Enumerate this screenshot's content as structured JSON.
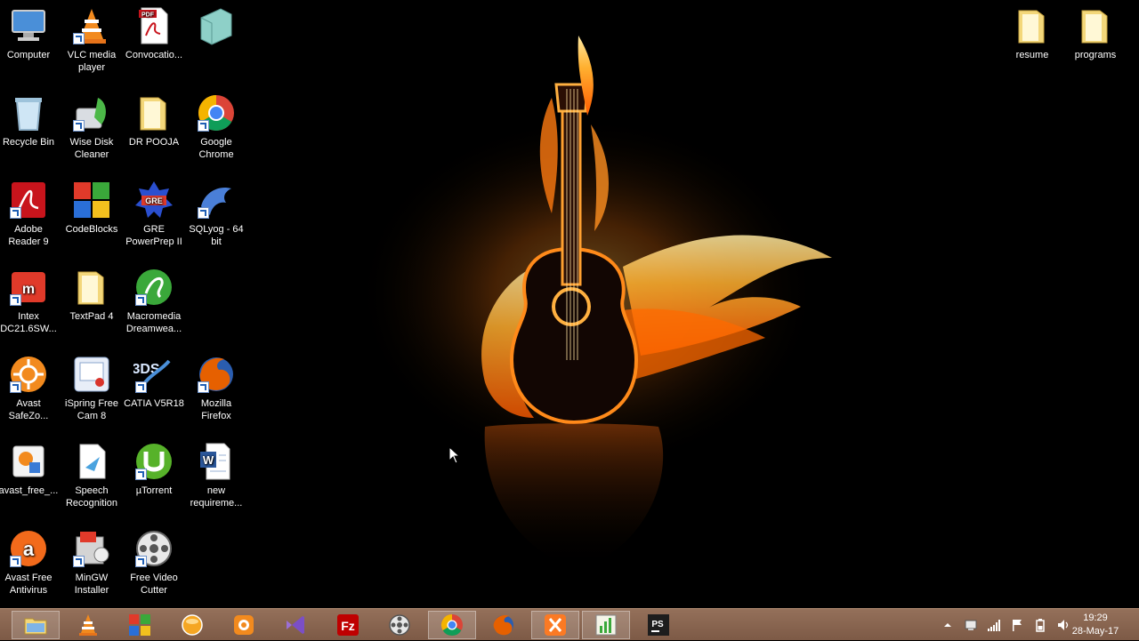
{
  "desktop": {
    "icons": [
      {
        "label": "Computer",
        "icon": "computer-icon"
      },
      {
        "label": "VLC media player",
        "icon": "vlc-icon"
      },
      {
        "label": "Convocatio...",
        "icon": "pdf-file-icon"
      },
      {
        "label": "",
        "icon": "generic-app-icon"
      },
      {
        "label": "Recycle Bin",
        "icon": "recycle-bin-icon"
      },
      {
        "label": "Wise Disk Cleaner",
        "icon": "wise-disk-cleaner-icon"
      },
      {
        "label": "DR POOJA",
        "icon": "folder-icon"
      },
      {
        "label": "Google Chrome",
        "icon": "chrome-icon"
      },
      {
        "label": "Adobe Reader 9",
        "icon": "adobe-reader-icon"
      },
      {
        "label": "CodeBlocks",
        "icon": "codeblocks-icon"
      },
      {
        "label": "GRE PowerPrep II",
        "icon": "gre-icon"
      },
      {
        "label": "SQLyog - 64 bit",
        "icon": "sqlyog-icon"
      },
      {
        "label": "Intex DC21.6SW...",
        "icon": "intex-icon"
      },
      {
        "label": "TextPad 4",
        "icon": "folder-icon"
      },
      {
        "label": "Macromedia Dreamwea...",
        "icon": "dreamweaver-icon"
      },
      {
        "label": "Avast SafeZo...",
        "icon": "avast-safezone-icon"
      },
      {
        "label": "iSpring Free Cam 8",
        "icon": "ispring-icon"
      },
      {
        "label": "CATIA V5R18",
        "icon": "catia-icon"
      },
      {
        "label": "Mozilla Firefox",
        "icon": "firefox-icon"
      },
      {
        "label": "avast_free_...",
        "icon": "installer-icon"
      },
      {
        "label": "Speech Recognition",
        "icon": "speech-recognition-icon"
      },
      {
        "label": "µTorrent",
        "icon": "utorrent-icon"
      },
      {
        "label": "new requireme...",
        "icon": "word-doc-icon"
      },
      {
        "label": "Avast Free Antivirus",
        "icon": "avast-icon"
      },
      {
        "label": "MinGW Installer",
        "icon": "mingw-icon"
      },
      {
        "label": "Free Video Cutter",
        "icon": "video-cutter-icon"
      },
      {
        "label": "resume",
        "icon": "folder-icon"
      },
      {
        "label": "programs",
        "icon": "folder-icon"
      }
    ]
  },
  "taskbar": {
    "pinned": [
      {
        "name": "file-explorer",
        "icon": "folder-icon",
        "active": true
      },
      {
        "name": "vlc",
        "icon": "vlc-icon",
        "active": false
      },
      {
        "name": "codeblocks",
        "icon": "codeblocks-icon",
        "active": false
      },
      {
        "name": "orb-app",
        "icon": "orb-icon",
        "active": false
      },
      {
        "name": "paint-app",
        "icon": "paint-icon",
        "active": false
      },
      {
        "name": "visual-studio",
        "icon": "visual-studio-icon",
        "active": false
      },
      {
        "name": "filezilla",
        "icon": "filezilla-icon",
        "active": false
      },
      {
        "name": "video-cutter",
        "icon": "video-cutter-icon",
        "active": false
      },
      {
        "name": "chrome",
        "icon": "chrome-icon",
        "active": true
      },
      {
        "name": "firefox",
        "icon": "firefox-icon",
        "active": false
      },
      {
        "name": "xampp",
        "icon": "xampp-icon",
        "active": true
      },
      {
        "name": "chart-app",
        "icon": "chart-icon",
        "active": true
      },
      {
        "name": "phpstorm",
        "icon": "phpstorm-icon",
        "active": false
      }
    ],
    "tray": {
      "icons": [
        "chevron-up-icon",
        "network-icon",
        "signal-icon",
        "flag-icon",
        "battery-icon",
        "speaker-icon"
      ],
      "time": "19:29",
      "date": "28-May-17"
    }
  },
  "colors": {
    "taskbar": "#86624e",
    "flame": "#ff7a10"
  }
}
